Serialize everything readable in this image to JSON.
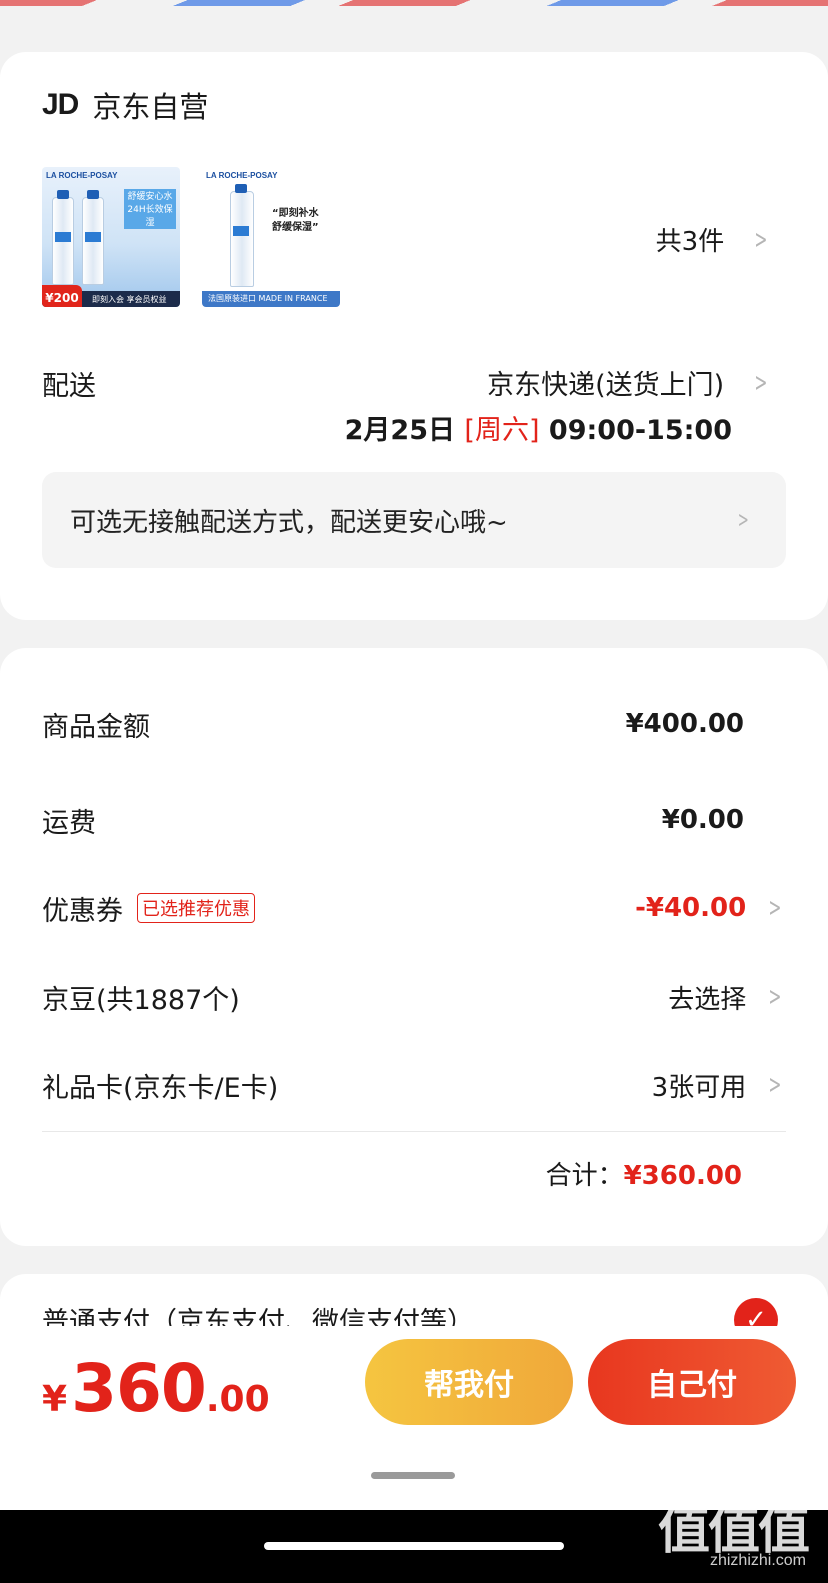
{
  "shop": {
    "logo": "JD",
    "name": "京东自营"
  },
  "products": {
    "item1": {
      "brand": "LA ROCHE-POSAY",
      "tag": "舒缓安心水\n24H长效保湿",
      "price": "¥200",
      "banner": "即刻入会 享会员权益"
    },
    "item2": {
      "brand": "LA ROCHE-POSAY",
      "slogan1": "“即刻补水",
      "slogan2": "舒缓保湿”",
      "banner": "法国原装进口 MADE IN FRANCE"
    },
    "count_label": "共3件"
  },
  "delivery": {
    "label": "配送",
    "method": "京东快递(送货上门)",
    "date": "2月25日",
    "weekday": "[周六]",
    "time_range": "09:00-15:00",
    "notice": "可选无接触配送方式，配送更安心哦~"
  },
  "summary": {
    "goods_label": "商品金额",
    "goods_value": "¥400.00",
    "shipping_label": "运费",
    "shipping_value": "¥0.00",
    "coupon_label": "优惠券",
    "coupon_badge": "已选推荐优惠",
    "coupon_value": "-¥40.00",
    "beans_label": "京豆(共1887个)",
    "beans_action": "去选择",
    "giftcard_label": "礼品卡(京东卡/E卡)",
    "giftcard_value": "3张可用",
    "total_label": "合计：",
    "total_value": "¥360.00"
  },
  "payment": {
    "method_label": "普通支付（京东支付、微信支付等）"
  },
  "footer": {
    "currency": "¥",
    "price_int": "360",
    "price_dec": ".00",
    "help_pay": "帮我付",
    "self_pay": "自己付"
  },
  "watermark": {
    "text": "值值值",
    "url": "zhizhizhi.com"
  },
  "colors": {
    "accent_red": "#e2231a",
    "help_yellow": "#f5c540"
  },
  "icons": {
    "chevron": "chevron-right-icon",
    "check": "check-circle-icon"
  }
}
